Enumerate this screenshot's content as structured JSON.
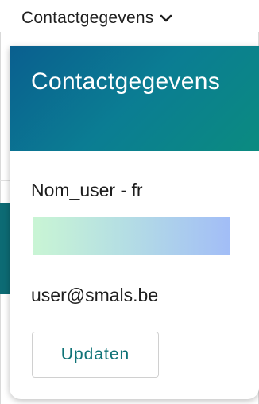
{
  "trigger": {
    "label": "Contactgegevens",
    "icon": "chevron-down-icon"
  },
  "panel": {
    "title": "Contactgegevens",
    "user_name": "Nom_user - fr",
    "email": "user@smals.be",
    "update_label": "Updaten"
  },
  "colors": {
    "header_start": "#0a5f8f",
    "header_end": "#0b8b80",
    "accent": "#0f7377"
  }
}
